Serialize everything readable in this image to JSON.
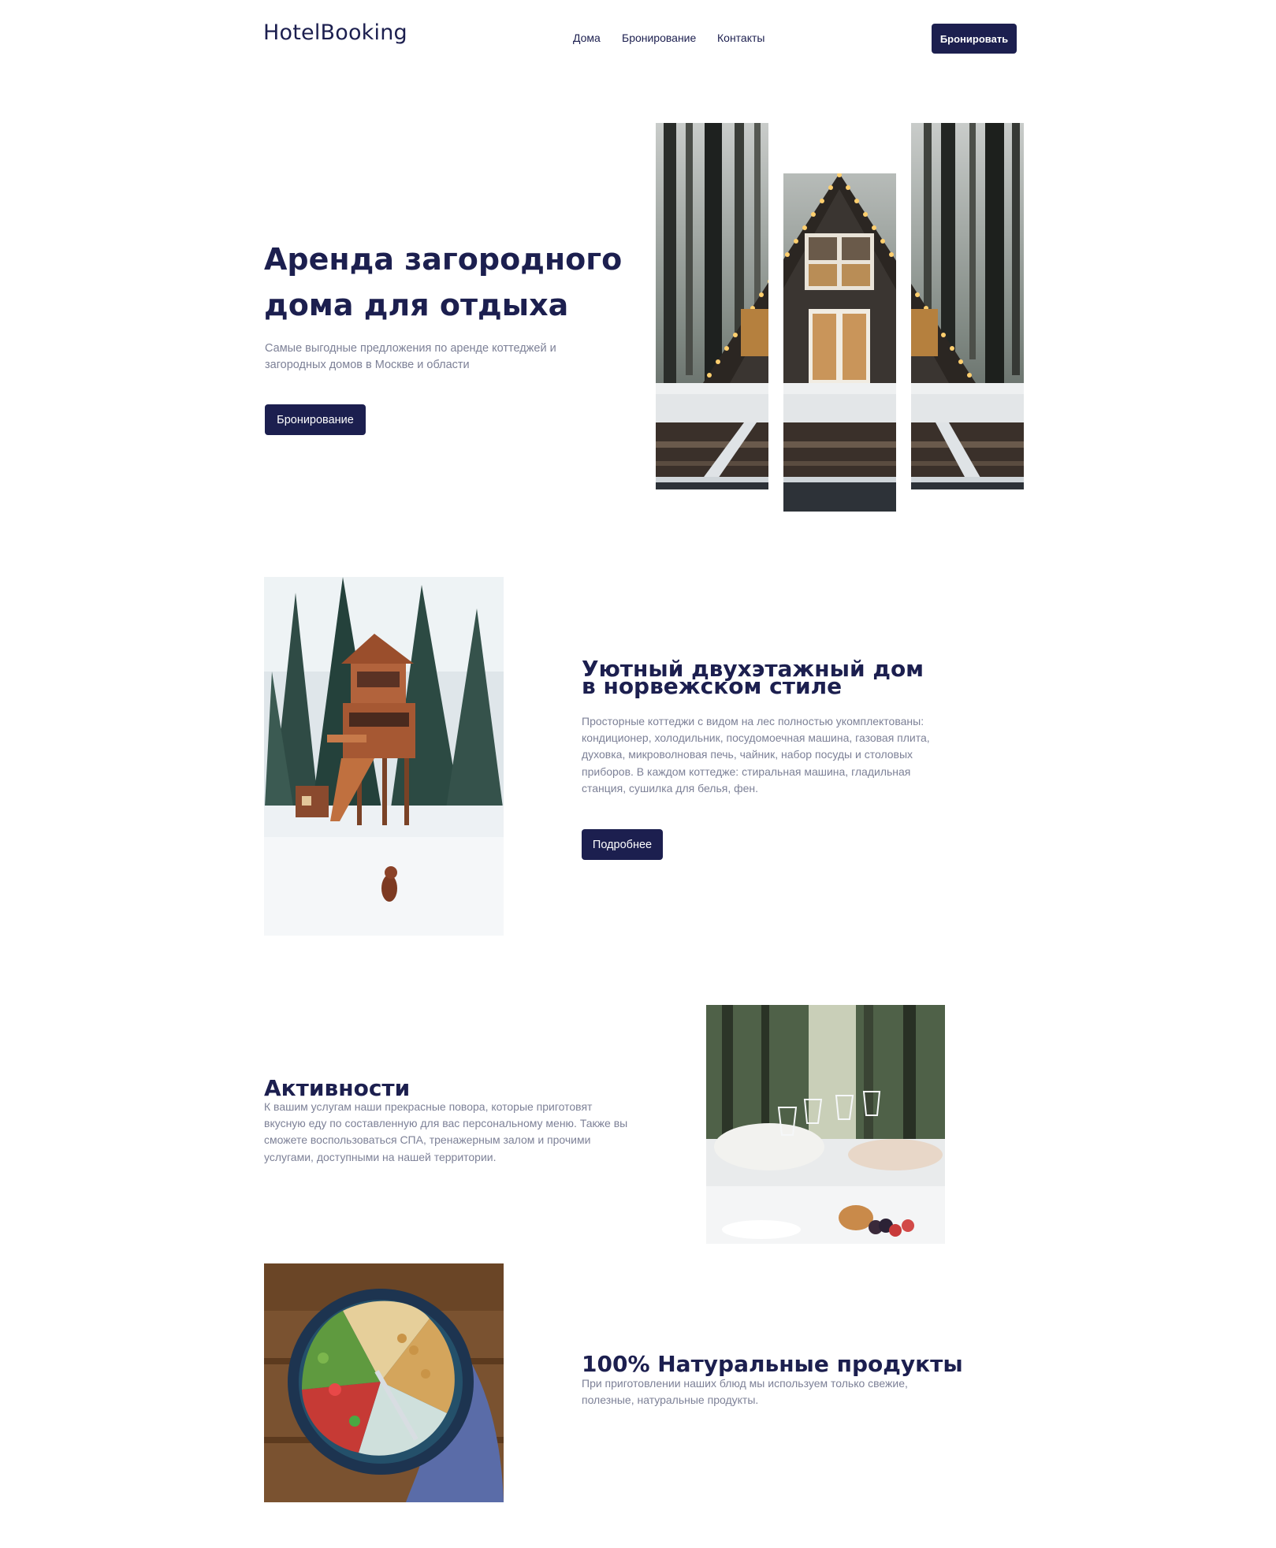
{
  "header": {
    "logo": "HotelBooking",
    "nav": [
      "Дома",
      "Бронирование",
      "Контакты"
    ],
    "cta_label": "Бронировать"
  },
  "hero": {
    "title": "Аренда загородного дома для отдыха",
    "subtitle": "Самые выгодные предложения по аренде коттеджей и загородных домов в Москве и области",
    "button_label": "Бронирование"
  },
  "house_section": {
    "title": "Уютный двухэтажный дом в норвежском стиле",
    "text": "Просторные коттеджи с видом на лес полностью укомплектованы: кондиционер, холодильник, посудомоечная машина, газовая плита, духовка, микроволновая печь, чайник, набор посуды и столовых приборов. В каждом коттедже: стиральная машина, гладильная станция, сушилка для белья, фен.",
    "button_label": "Подробнее"
  },
  "activities_section": {
    "title": "Активности",
    "text": "К вашим услугам наши прекрасные повора, которые приготовят вкусную еду по составленную для вас персональному меню. Также вы сможете воспользоваться СПА, тренажерным залом и прочими услугами, доступными на нашей территории."
  },
  "products_section": {
    "title": "100% Натуральные продукты",
    "text": "При приготовлении наших блюд мы используем только свежие, полезные, натуральные продукты."
  },
  "colors": {
    "primary": "#1c1f4f",
    "muted_text": "#7d8197",
    "background": "#ffffff"
  }
}
